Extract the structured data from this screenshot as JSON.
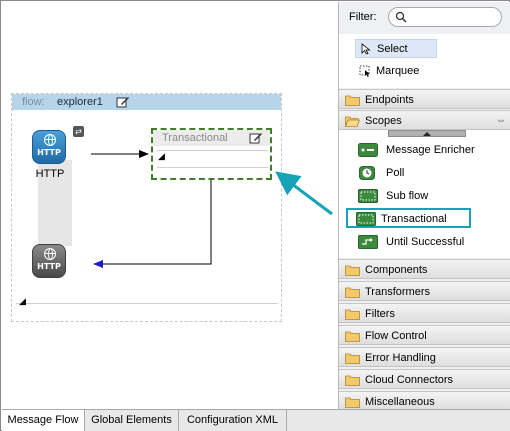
{
  "canvas": {
    "flow": {
      "key_label": "flow:",
      "name": "explorer1"
    },
    "http_endpoint": {
      "icon_text": "HTTP",
      "label": "HTTP",
      "response_icon_text": "HTTP"
    },
    "transactional_scope": {
      "title": "Transactional"
    }
  },
  "palette": {
    "filter": {
      "label": "Filter:",
      "value": ""
    },
    "tools": {
      "select": "Select",
      "marquee": "Marquee"
    },
    "categories": {
      "endpoints": "Endpoints",
      "scopes": "Scopes",
      "components": "Components",
      "transformers": "Transformers",
      "filters": "Filters",
      "flow_control": "Flow Control",
      "error_handling": "Error Handling",
      "cloud_connectors": "Cloud Connectors",
      "miscellaneous": "Miscellaneous"
    },
    "scope_items": {
      "message_enricher": "Message Enricher",
      "poll": "Poll",
      "sub_flow": "Sub flow",
      "transactional": "Transactional",
      "until_successful": "Until Successful"
    }
  },
  "tabs": {
    "message_flow": "Message Flow",
    "global_elements": "Global Elements",
    "configuration_xml": "Configuration XML"
  },
  "colors": {
    "highlight": "#16a3b7",
    "scope_border": "#3f7f2a",
    "flow_header": "#b6d5ea",
    "http_blue": "#1f6aa8",
    "response_arrow": "#1a1acc"
  }
}
